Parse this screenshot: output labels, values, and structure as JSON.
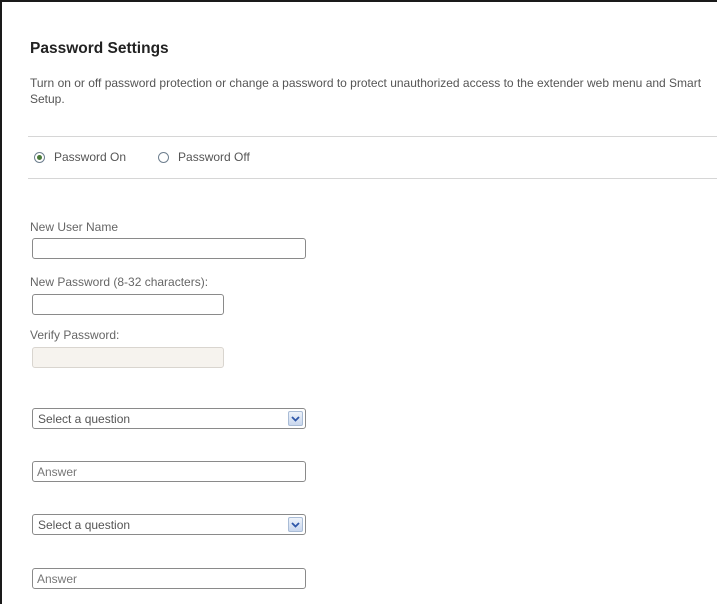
{
  "page": {
    "title": "Password Settings",
    "description": "Turn on or off password protection or change a password to protect unauthorized access to the extender web menu and Smart Setup."
  },
  "password_mode": {
    "options": [
      {
        "label": "Password On",
        "checked": true
      },
      {
        "label": "Password Off",
        "checked": false
      }
    ]
  },
  "form": {
    "username_label": "New User Name",
    "username_value": "",
    "password_label": "New Password (8-32 characters):",
    "password_value": "",
    "verify_label": "Verify Password:",
    "verify_value": ""
  },
  "security_questions": [
    {
      "question_value": "Select a question",
      "answer_placeholder": "Answer"
    },
    {
      "question_value": "Select a question",
      "answer_placeholder": "Answer"
    }
  ],
  "icons": {
    "dropdown_arrow": "chevron-down-icon"
  },
  "colors": {
    "radio_selected": "#4a7a3a",
    "dropdown_arrow": "#2f57a8",
    "disabled_input_bg": "#f6f3ee"
  }
}
